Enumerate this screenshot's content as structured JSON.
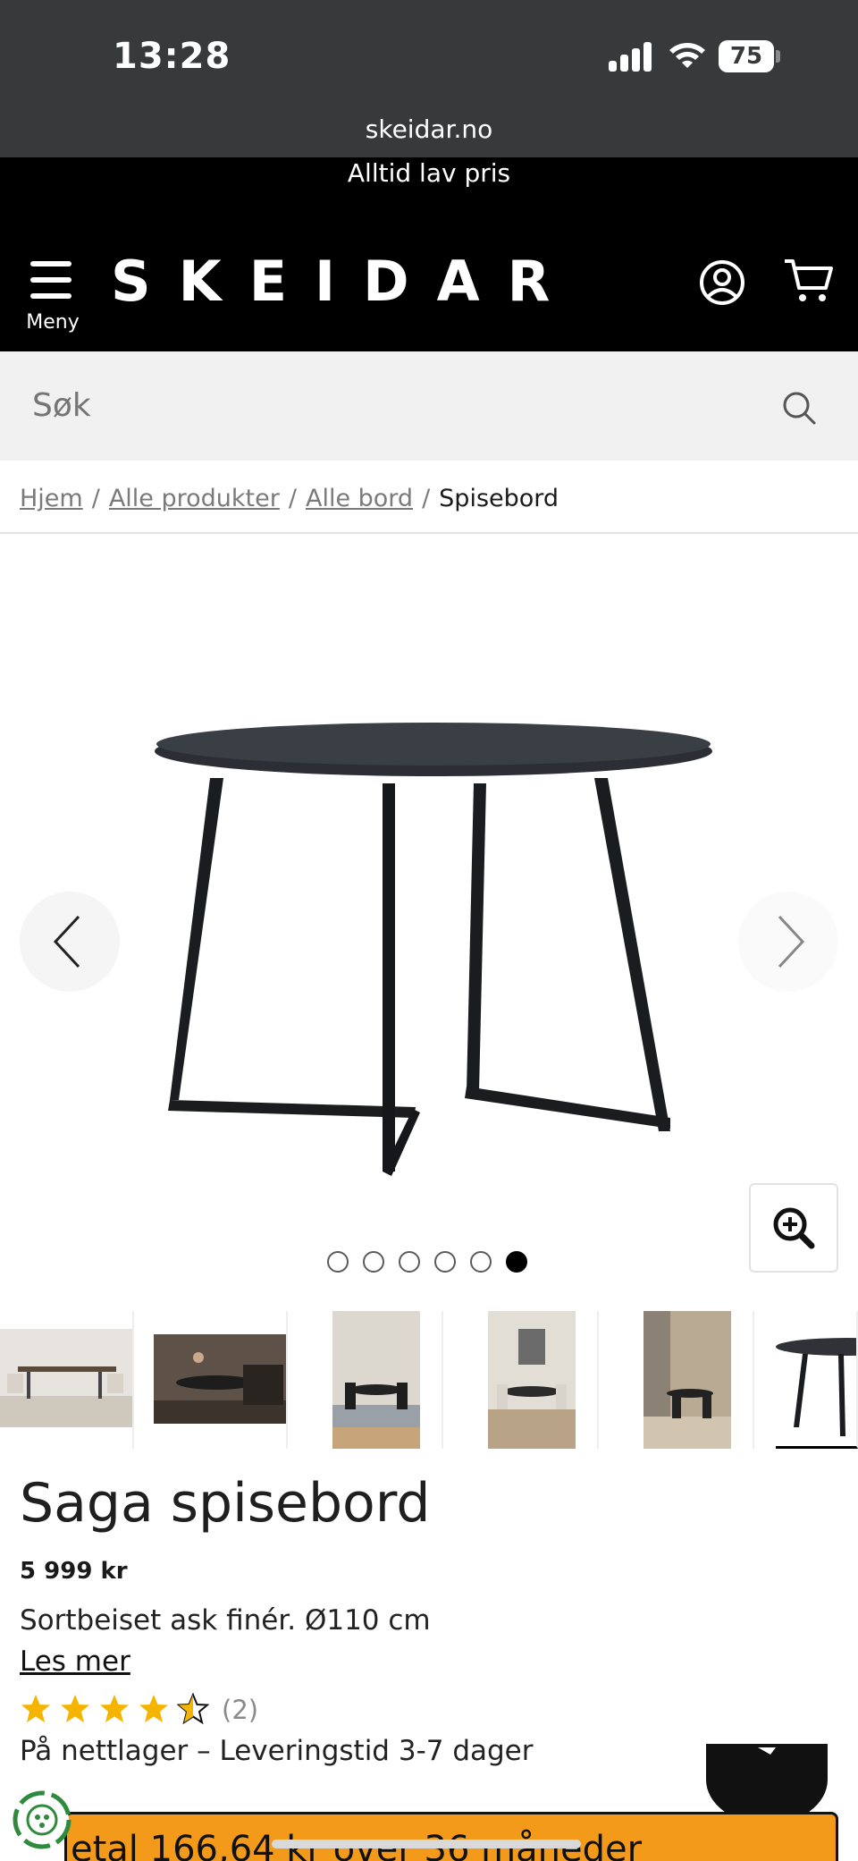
{
  "status_bar": {
    "time": "13:28",
    "battery": "75"
  },
  "browser": {
    "url": "skeidar.no"
  },
  "header": {
    "promo": "Alltid lav pris",
    "menu_label": "Meny",
    "logo": "SKEIDAR",
    "icons": [
      "menu-icon",
      "account-icon",
      "cart-icon"
    ]
  },
  "search": {
    "placeholder": "Søk"
  },
  "breadcrumb": {
    "items": [
      "Hjem",
      "Alle produkter",
      "Alle bord"
    ],
    "current": "Spisebord"
  },
  "gallery": {
    "dot_count": 6,
    "active_index": 5,
    "thumbnail_count": 6
  },
  "product": {
    "title": "Saga spisebord",
    "price": "5 999 kr",
    "description": "Sortbeiset ask finér. Ø110 cm",
    "read_more": "Les mer",
    "rating": 4.5,
    "rating_count": "(2)",
    "availability": "På nettlager – Leveringstid 3-7 dager",
    "finance_text": "etal 166,64 kr over 36 måneder"
  },
  "colors": {
    "accent_star": "#f5b400",
    "finance_bar": "#f39a1a",
    "header_bg": "#000000"
  }
}
